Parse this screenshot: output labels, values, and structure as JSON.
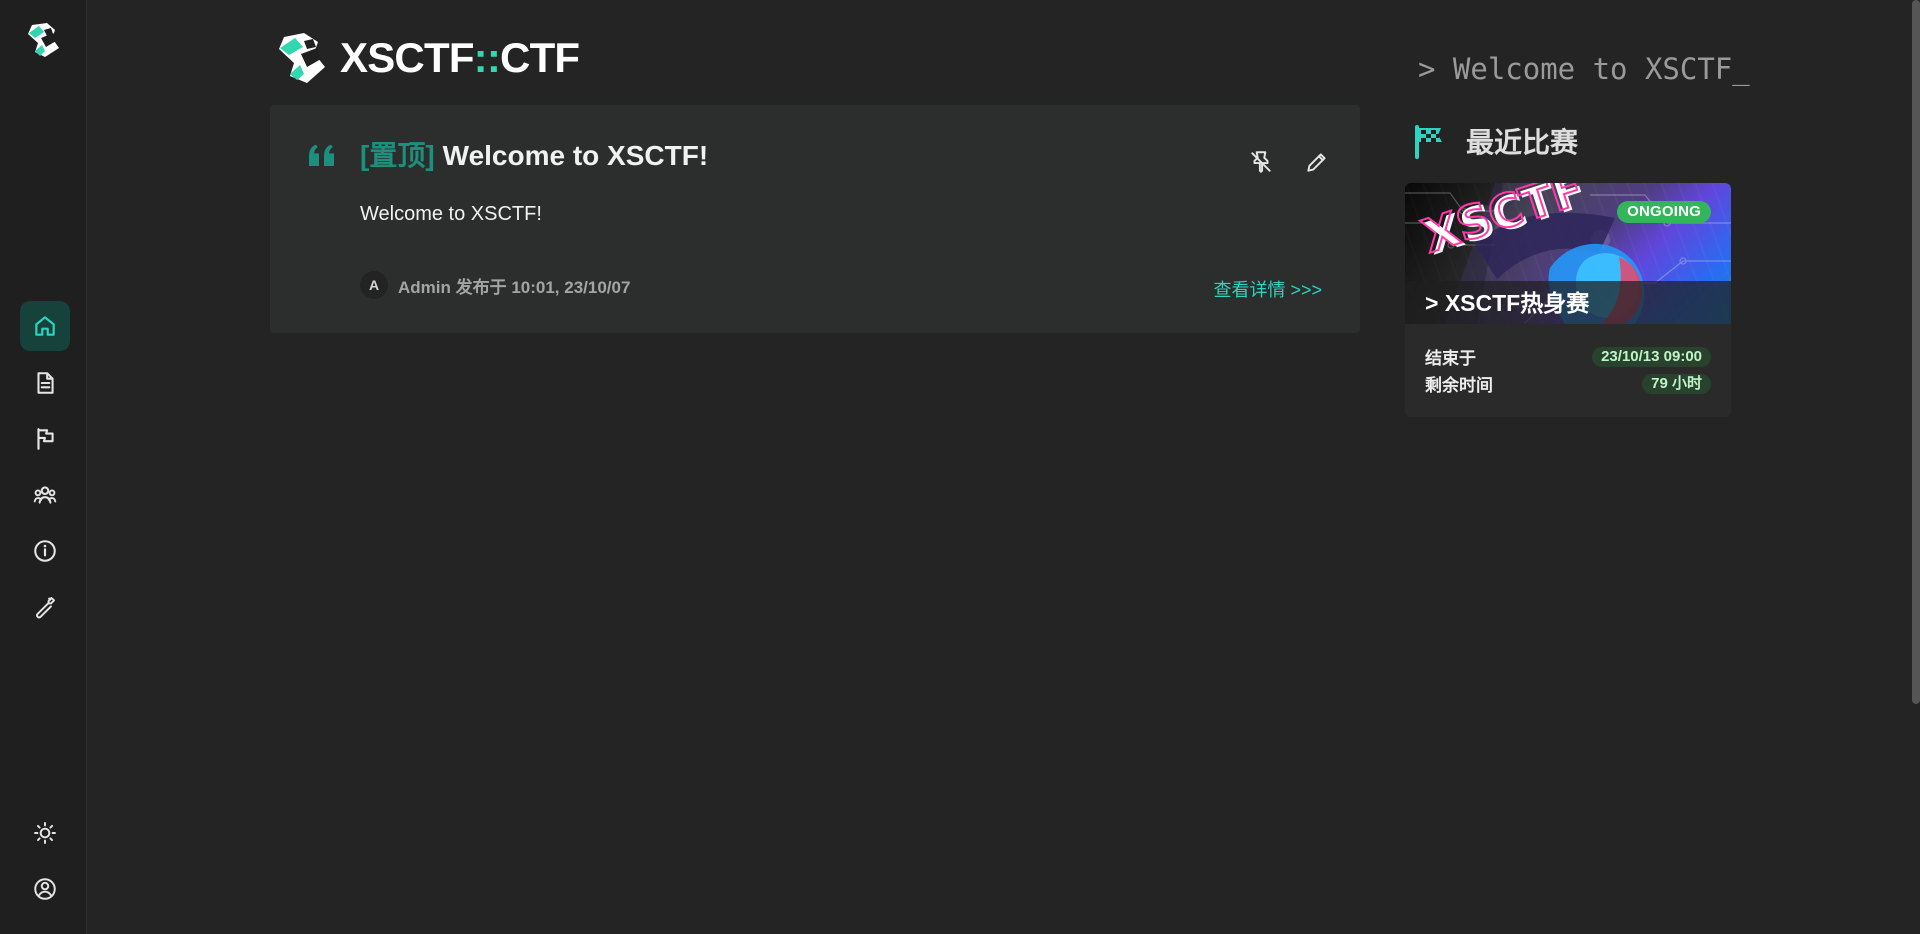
{
  "app": {
    "brand": {
      "prefix": "XSCTF",
      "separator": "::",
      "suffix": "CTF"
    }
  },
  "sidebar": {
    "logo_icon": "xsctf-logo-icon",
    "items": [
      {
        "name": "home",
        "icon": "home-icon"
      },
      {
        "name": "posts",
        "icon": "document-icon"
      },
      {
        "name": "games",
        "icon": "flag-icon"
      },
      {
        "name": "teams",
        "icon": "users-icon"
      },
      {
        "name": "about",
        "icon": "info-icon"
      },
      {
        "name": "tools",
        "icon": "wrench-icon"
      }
    ],
    "bottom": [
      {
        "name": "theme",
        "icon": "sun-icon"
      },
      {
        "name": "user",
        "icon": "user-circle-icon"
      }
    ]
  },
  "post": {
    "pinned_tag": "[置顶]",
    "title": "Welcome to XSCTF!",
    "content": "Welcome to XSCTF!",
    "author_initial": "A",
    "meta": "Admin 发布于 10:01, 23/10/07",
    "details_link": "查看详情 >>>",
    "actions": [
      {
        "name": "unpin",
        "icon": "pin-off-icon"
      },
      {
        "name": "edit",
        "icon": "pencil-icon"
      }
    ]
  },
  "right_panel": {
    "terminal_text": "> Welcome to XSCTF_",
    "recent_title": "最近比赛",
    "recent_icon": "checkered-flag-icon",
    "game": {
      "status": "ONGOING",
      "title": "> XSCTF热身赛",
      "ends_label": "结束于",
      "ends_value": "23/10/13 09:00",
      "remaining_label": "剩余时间",
      "remaining_value": "79 小时"
    }
  },
  "colors": {
    "background": "#242424",
    "sidebar_background": "#1f1f1f",
    "card_background": "#2c2e2e",
    "accent": "#2dd4bf",
    "accent_dark": "#1c8f7d",
    "muted_text": "#a4a4a4",
    "status_green": "#35b55b"
  }
}
